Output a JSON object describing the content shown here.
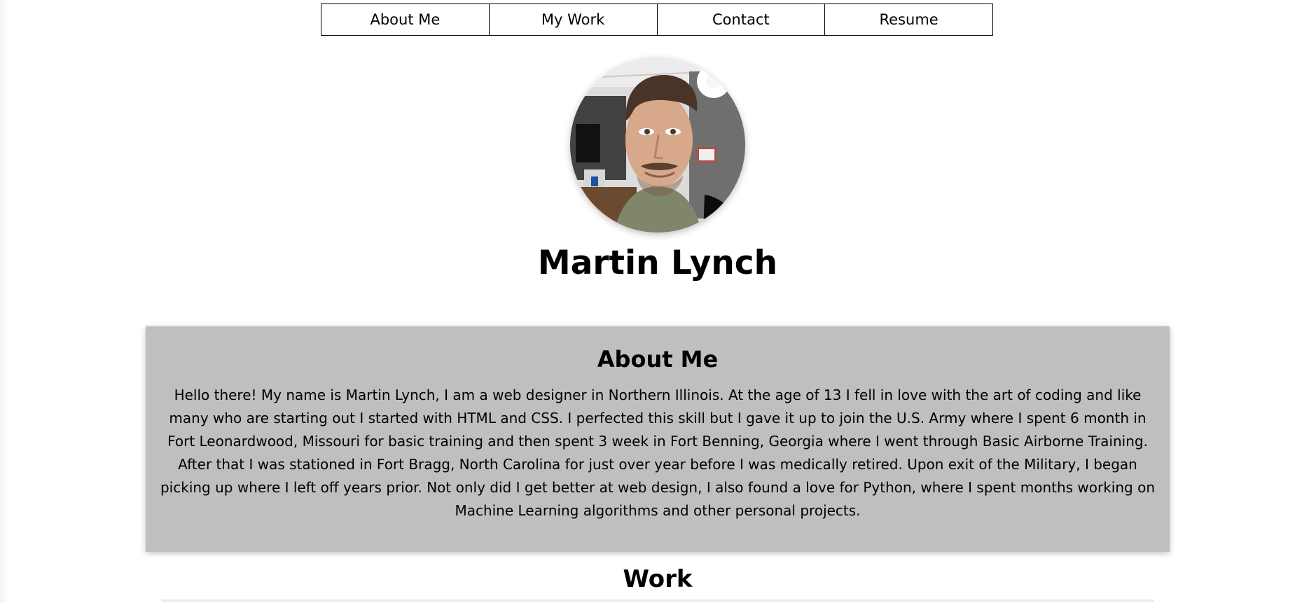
{
  "nav": {
    "items": [
      {
        "label": "About Me"
      },
      {
        "label": "My Work"
      },
      {
        "label": "Contact"
      },
      {
        "label": "Resume"
      }
    ]
  },
  "profile": {
    "name": "Martin Lynch",
    "photo_icon": "profile-photo"
  },
  "about": {
    "title": "About Me",
    "text": "Hello there! My name is Martin Lynch, I am a web designer in Northern Illinois. At the age of 13 I fell in love with the art of coding and like many who are starting out I started with HTML and CSS. I perfected this skill but I gave it up to join the U.S. Army where I spent 6 month in Fort Leonardwood, Missouri for basic training and then spent 3 week in Fort Benning, Georgia where I went through Basic Airborne Training. After that I was stationed in Fort Bragg, North Carolina for just over year before I was medically retired. Upon exit of the Military, I began picking up where I left off years prior. Not only did I get better at web design, I also found a love for Python, where I spent months working on Machine Learning algorithms and other personal projects."
  },
  "work": {
    "title": "Work"
  },
  "colors": {
    "card_background": "#bfbfbf",
    "page_background": "#ffffff",
    "text": "#000000",
    "border": "#000000"
  }
}
